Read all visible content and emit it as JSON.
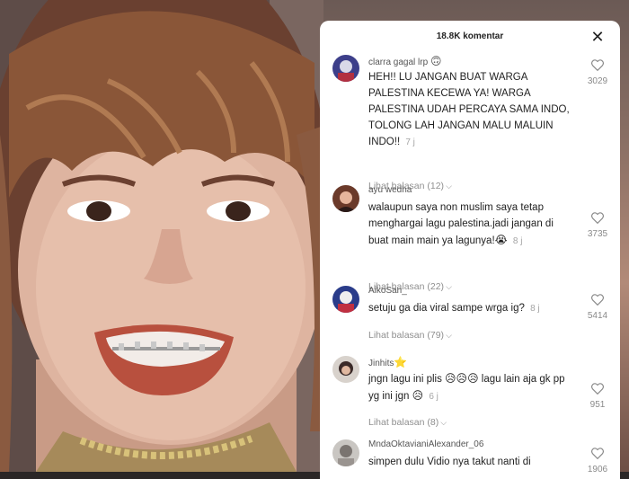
{
  "header": {
    "title": "18.8K komentar",
    "close_label": "✕"
  },
  "comments": [
    {
      "username": "clarra gagal lrp",
      "username_emoji": "🙃",
      "text": "HEH!! LU JANGAN BUAT WARGA PALESTINA KECEWA YA! WARGA PALESTINA UDAH PERCAYA SAMA INDO, TOLONG LAH JANGAN MALU MALUIN INDO!!",
      "time": "7 j",
      "replies": "Lihat balasan (12)",
      "likes": "3029"
    },
    {
      "username": "ayu wedha",
      "username_emoji": "",
      "text": "walaupun saya non muslim saya tetap menghargai lagu palestina.jadi jangan di buat main main ya lagunya!",
      "text_emoji": "😭",
      "time": "8 j",
      "replies": "Lihat balasan (22)",
      "likes": "3735"
    },
    {
      "username": "AikoSan_",
      "username_emoji": "",
      "text": "setuju ga dia viral sampe wrga ig?",
      "time": "8 j",
      "replies": "Lihat balasan (79)",
      "likes": "5414"
    },
    {
      "username": "Jinhits",
      "username_emoji": "⭐",
      "text_part1": "jngn lagu ini plis",
      "text_emoji1": "😥😥😥",
      "text_part2": "lagu lain aja gk pp yg ini jgn",
      "text_emoji2": "😥",
      "time": "6 j",
      "replies": "Lihat balasan (8)",
      "likes": "951"
    },
    {
      "username": "MndaOktavianiAlexander_06",
      "username_emoji": "",
      "text": "simpen dulu Vidio nya takut nanti di",
      "likes": "1906"
    }
  ],
  "icons": {
    "like": "heart-outline-icon",
    "chevron": "chevron-down-icon",
    "close": "close-icon"
  },
  "colors": {
    "panel_bg": "#ffffff",
    "muted": "#8f8f8f",
    "text": "#222222"
  }
}
